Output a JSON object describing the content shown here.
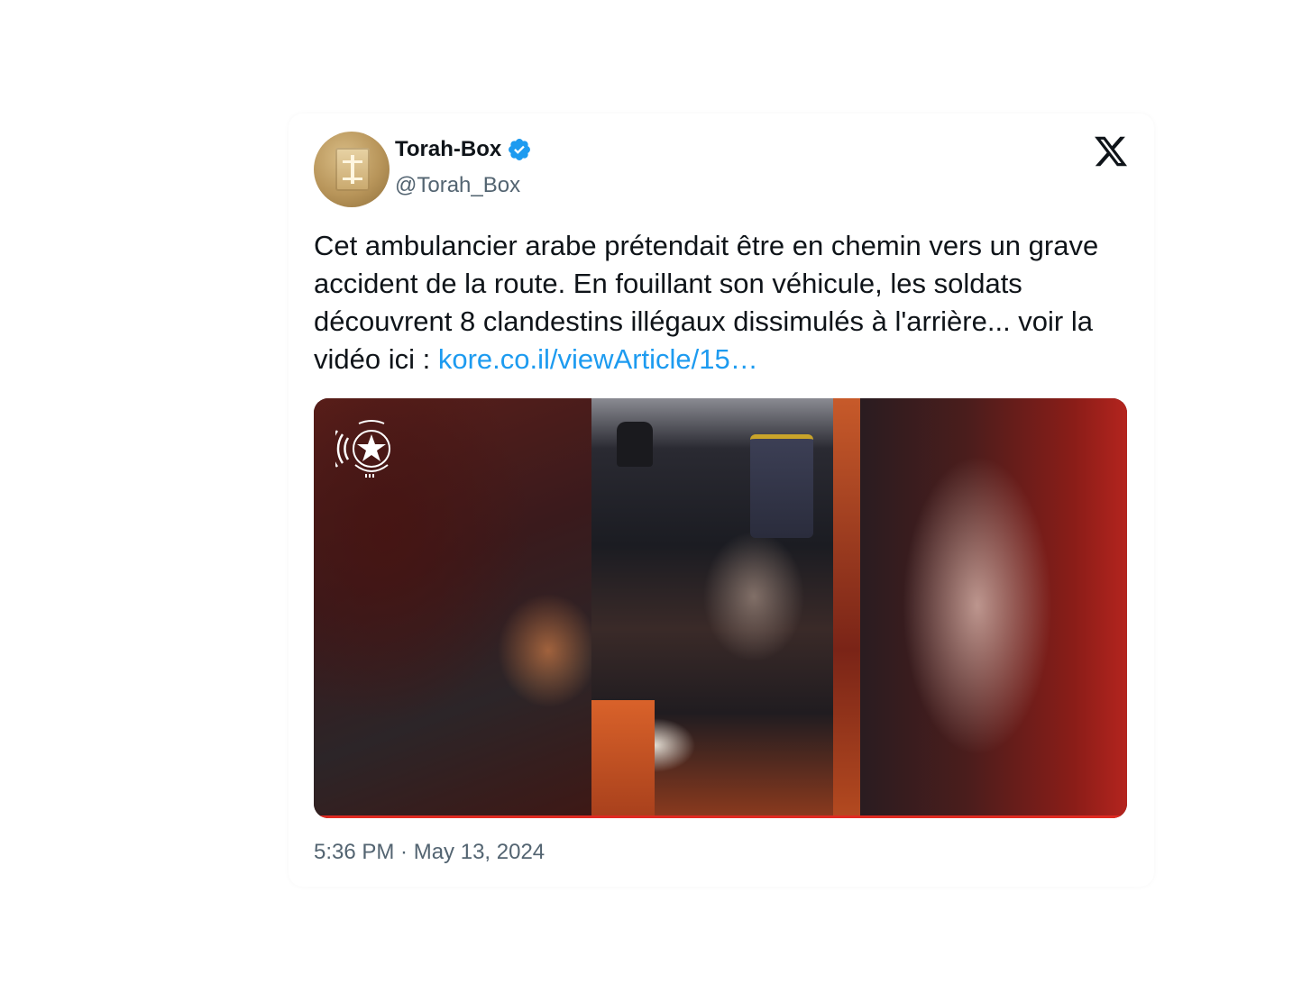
{
  "tweet": {
    "author": {
      "display_name": "Torah-Box",
      "handle": "@Torah_Box",
      "verified": true,
      "avatar_icon": "cardboard-box-avatar"
    },
    "platform_icon": "x-logo-icon",
    "text_before_link": "Cet ambulancier arabe prétendait être en chemin vers un grave accident de la route. En fouillant son véhicule, les soldats découvrent 8 clandestins illégaux dissimulés à l'arrière... voir la vidéo ici : ",
    "link_text": "kore.co.il/viewArticle/15…",
    "media": {
      "type": "video-thumbnail",
      "overlay_icon": "israel-police-emblem-icon"
    },
    "timestamp": "5:36 PM · May 13, 2024"
  },
  "colors": {
    "text_primary": "#0f1419",
    "text_secondary": "#536471",
    "link": "#1d9bf0",
    "verified_badge": "#1d9bf0"
  }
}
